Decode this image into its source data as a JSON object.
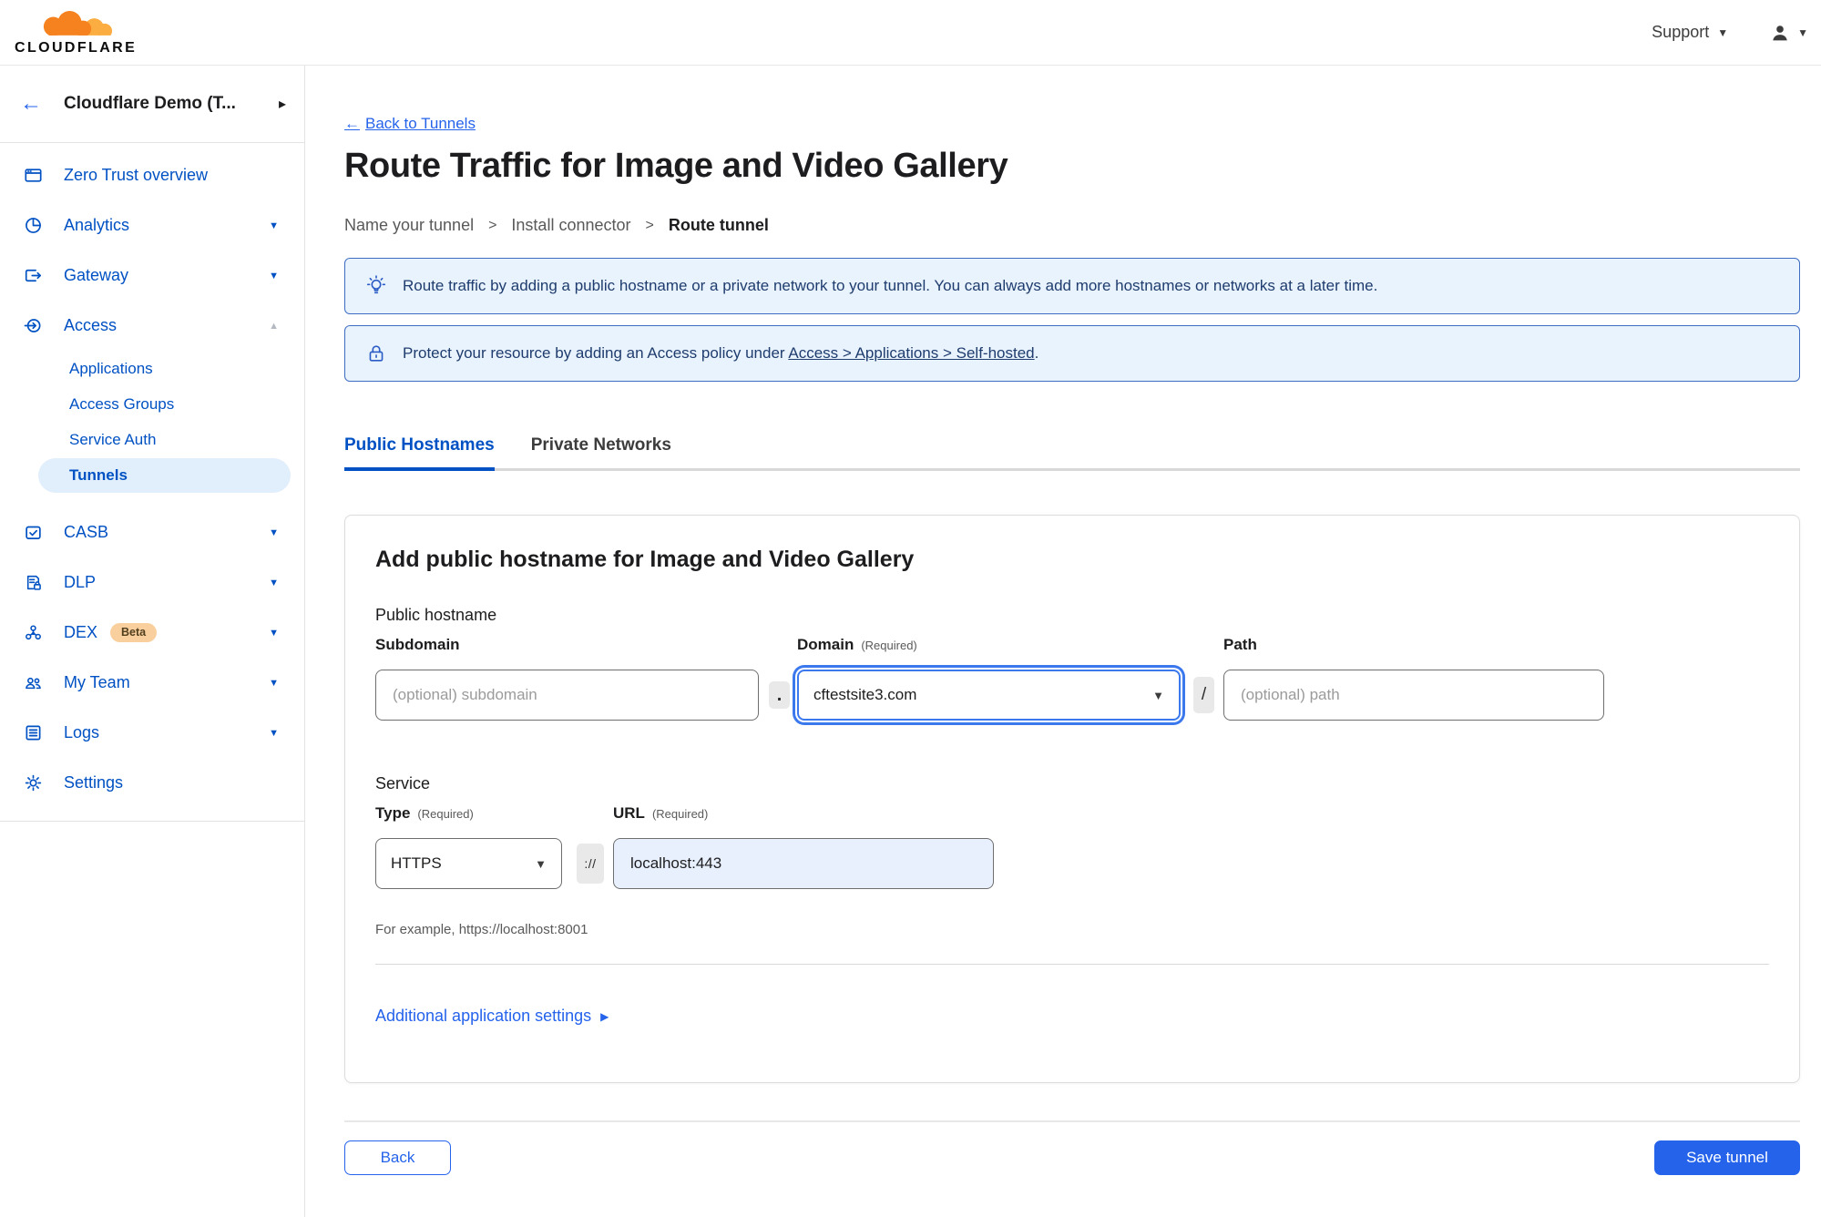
{
  "topbar": {
    "brand": "CLOUDFLARE",
    "support_label": "Support"
  },
  "icons": {
    "caret_down": "▼",
    "caret_up": "▲",
    "caret_right": "▸",
    "back_arrow": "←",
    "play_right": "▶"
  },
  "sidebar": {
    "account_label": "Cloudflare Demo (T...",
    "items": [
      {
        "label": "Zero Trust overview",
        "icon": "window-icon",
        "caret": null
      },
      {
        "label": "Analytics",
        "icon": "pie-chart-icon",
        "caret": "down"
      },
      {
        "label": "Gateway",
        "icon": "gateway-icon",
        "caret": "down"
      },
      {
        "label": "Access",
        "icon": "access-icon",
        "caret": "up",
        "children": [
          "Applications",
          "Access Groups",
          "Service Auth",
          "Tunnels"
        ],
        "active_child": "Tunnels"
      },
      {
        "label": "CASB",
        "icon": "casb-icon",
        "caret": "down"
      },
      {
        "label": "DLP",
        "icon": "dlp-icon",
        "caret": "down"
      },
      {
        "label": "DEX",
        "icon": "dex-icon",
        "badge": "Beta",
        "caret": "down"
      },
      {
        "label": "My Team",
        "icon": "team-icon",
        "caret": "down"
      },
      {
        "label": "Logs",
        "icon": "logs-icon",
        "caret": "down"
      },
      {
        "label": "Settings",
        "icon": "gear-icon",
        "caret": null
      }
    ]
  },
  "main": {
    "back_link_label": "Back to Tunnels",
    "title": "Route Traffic for Image and Video Gallery",
    "steps": [
      "Name your tunnel",
      "Install connector",
      "Route tunnel"
    ],
    "step_separator": ">",
    "banners": [
      {
        "icon": "lightbulb-icon",
        "text": "Route traffic by adding a public hostname or a private network to your tunnel. You can always add more hostnames or networks at a later time."
      },
      {
        "icon": "lock-icon",
        "text_before": "Protect your resource by adding an Access policy under ",
        "link": "Access > Applications > Self-hosted",
        "text_after": "."
      }
    ],
    "tabs": [
      "Public Hostnames",
      "Private Networks"
    ],
    "active_tab": "Public Hostnames",
    "form": {
      "heading": "Add public hostname for Image and Video Gallery",
      "public_hostname_label": "Public hostname",
      "subdomain": {
        "label": "Subdomain",
        "placeholder": "(optional) subdomain"
      },
      "domain": {
        "label": "Domain",
        "required_hint": "(Required)",
        "value": "cftestsite3.com"
      },
      "path": {
        "label": "Path",
        "placeholder": "(optional) path"
      },
      "separators": {
        "dot": ".",
        "slash": "/",
        "scheme": "://"
      },
      "service_label": "Service",
      "type": {
        "label": "Type",
        "required_hint": "(Required)",
        "value": "HTTPS"
      },
      "url": {
        "label": "URL",
        "required_hint": "(Required)",
        "value": "localhost:443"
      },
      "example_text": "For example, https://localhost:8001",
      "additional_settings_label": "Additional application settings"
    },
    "footer": {
      "back_label": "Back",
      "save_label": "Save tunnel"
    }
  },
  "colors": {
    "brand_orange": "#f6821f",
    "brand_orange_light": "#fbad41",
    "nav_blue": "#0051c3",
    "link_blue": "#2563eb",
    "banner_bg": "#e9f3fd",
    "banner_border": "#3d6cc2",
    "banner_text": "#1e3c6e",
    "active_pill_bg": "#e1eefb",
    "url_field_bg": "#e8f0fe",
    "beta_badge_bg": "#f9cf9e",
    "focus_ring": "#3b78ee"
  }
}
